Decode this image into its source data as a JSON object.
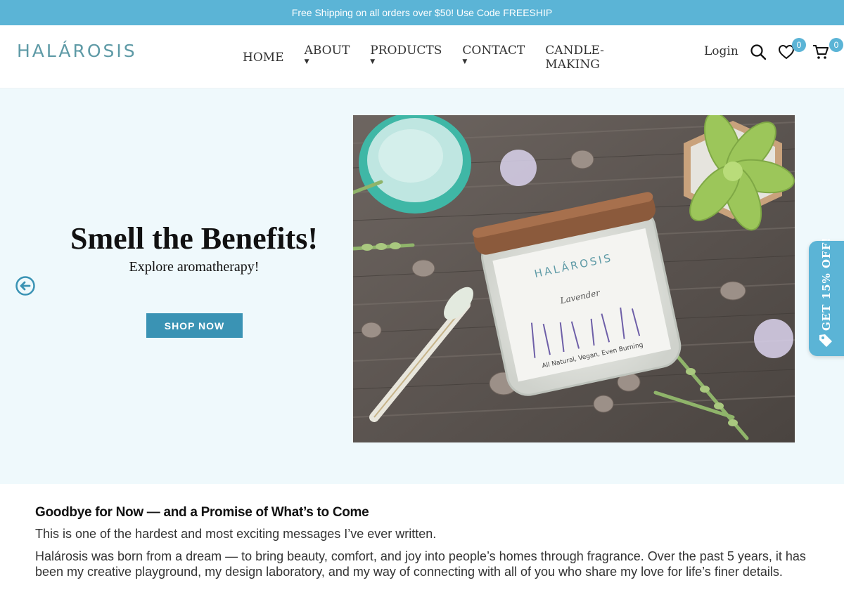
{
  "announcement": "Free Shipping on all orders over $50! Use Code FREESHIP",
  "logo_text": "HALÁROSIS",
  "nav": {
    "items": [
      {
        "label": "HOME"
      },
      {
        "label": "ABOUT"
      },
      {
        "label": "PRODUCTS"
      },
      {
        "label": "CONTACT"
      },
      {
        "label": "CANDLE-MAKING"
      }
    ],
    "login": "Login",
    "wishlist_count": "0",
    "cart_count": "0"
  },
  "hero": {
    "title": "Smell the Benefits!",
    "subtitle": "Explore aromatherapy!",
    "button": "SHOP NOW",
    "jar_label": "HALÁROSIS",
    "jar_scent": "Lavender",
    "jar_tagline": "All Natural, Vegan, Even Burning"
  },
  "side_tab": "GET 15% OFF!",
  "article": {
    "heading": "Goodbye for Now — and a Promise of What’s to Come",
    "p1": "This is one of the hardest and most exciting messages I’ve ever written.",
    "p2": "Halárosis was born from a dream — to bring beauty, comfort, and joy into people’s homes through fragrance. Over the past 5 years, it has been my creative playground, my design laboratory, and my way of connecting with all of you who share my love for life’s finer details."
  },
  "colors": {
    "accent": "#5bb4d6",
    "button": "#3a93b4",
    "hero_bg": "#eff9fc",
    "logo": "#5e9aa6"
  }
}
